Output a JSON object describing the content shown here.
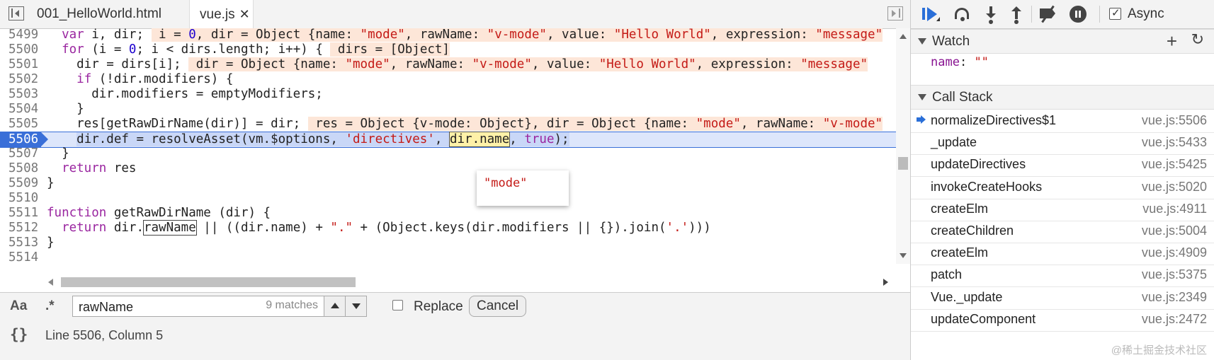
{
  "tabs": [
    {
      "label": "001_HelloWorld.html"
    },
    {
      "label": "vue.js"
    }
  ],
  "code": {
    "lines": [
      {
        "n": "5499",
        "html": "  <span class=\"kw\">var</span> i, dir; <span class=\"inl\"> i = <span class=\"num\">0</span>, dir = Object {name: <span class=\"str\">\"mode\"</span>, rawName: <span class=\"str\">\"v-mode\"</span>, value: <span class=\"str\">\"Hello World\"</span>, expression: <span class=\"str\">\"message\"</span></span>"
      },
      {
        "n": "5500",
        "html": "  <span class=\"kw\">for</span> (i = <span class=\"num\">0</span>; i &lt; dirs.length; i++) { <span class=\"inl\"> dirs = [Object]</span>"
      },
      {
        "n": "5501",
        "html": "    dir = dirs[i]; <span class=\"inl\"> dir = Object {name: <span class=\"str\">\"mode\"</span>, rawName: <span class=\"str\">\"v-mode\"</span>, value: <span class=\"str\">\"Hello World\"</span>, expression: <span class=\"str\">\"message\"</span></span>"
      },
      {
        "n": "5502",
        "html": "    <span class=\"kw\">if</span> (!dir.modifiers) {"
      },
      {
        "n": "5503",
        "html": "      dir.modifiers = emptyModifiers;"
      },
      {
        "n": "5504",
        "html": "    }"
      },
      {
        "n": "5505",
        "html": "    res[getRawDirName(dir)] = dir; <span class=\"inl\"> res = Object {v-mode: Object}, dir = Object {name: <span class=\"str\">\"mode\"</span>, rawName: <span class=\"str\">\"v-mode\"</span></span>"
      },
      {
        "n": "5506",
        "html": "    <span class=\"sel\">dir.def = resolveAsset(vm.$options, <span class=\"str\">'directives'</span>, </span><span class=\"hl\">dir.name</span><span class=\"sel\">, <span class=\"kw\">true</span>);</span>",
        "current": true
      },
      {
        "n": "5507",
        "html": "  }"
      },
      {
        "n": "5508",
        "html": "  <span class=\"kw\">return</span> res"
      },
      {
        "n": "5509",
        "html": "}"
      },
      {
        "n": "5510",
        "html": ""
      },
      {
        "n": "5511",
        "html": "<span class=\"kw\">function</span> getRawDirName (dir) {"
      },
      {
        "n": "5512",
        "html": "  <span class=\"kw\">return</span> dir.<span class=\"box\">rawName</span> || ((dir.name) + <span class=\"str\">\".\"</span> + (Object.keys(dir.modifiers || {}).join(<span class=\"str\">'.'</span>)))"
      },
      {
        "n": "5513",
        "html": "}"
      },
      {
        "n": "5514",
        "html": ""
      }
    ]
  },
  "tooltip": {
    "value": "\"mode\""
  },
  "search": {
    "case_label": "Aa",
    "regex_label": ".*",
    "query": "rawName",
    "matches": "9 matches",
    "replace_label": "Replace",
    "cancel_label": "Cancel"
  },
  "status": {
    "format_label": "{}",
    "position": "Line 5506, Column 5"
  },
  "debugger": {
    "async_label": "Async",
    "watch_title": "Watch",
    "watch_items": [
      {
        "key": "name",
        "value": "\"\""
      }
    ],
    "callstack_title": "Call Stack",
    "frames": [
      {
        "fn": "normalizeDirectives$1",
        "loc": "vue.js:5506",
        "current": true
      },
      {
        "fn": "_update",
        "loc": "vue.js:5433"
      },
      {
        "fn": "updateDirectives",
        "loc": "vue.js:5425"
      },
      {
        "fn": "invokeCreateHooks",
        "loc": "vue.js:5020"
      },
      {
        "fn": "createElm",
        "loc": "vue.js:4911"
      },
      {
        "fn": "createChildren",
        "loc": "vue.js:5004"
      },
      {
        "fn": "createElm",
        "loc": "vue.js:4909"
      },
      {
        "fn": "patch",
        "loc": "vue.js:5375"
      },
      {
        "fn": "Vue._update",
        "loc": "vue.js:2349"
      },
      {
        "fn": "updateComponent",
        "loc": "vue.js:2472"
      }
    ]
  },
  "watermark": "@稀土掘金技术社区"
}
